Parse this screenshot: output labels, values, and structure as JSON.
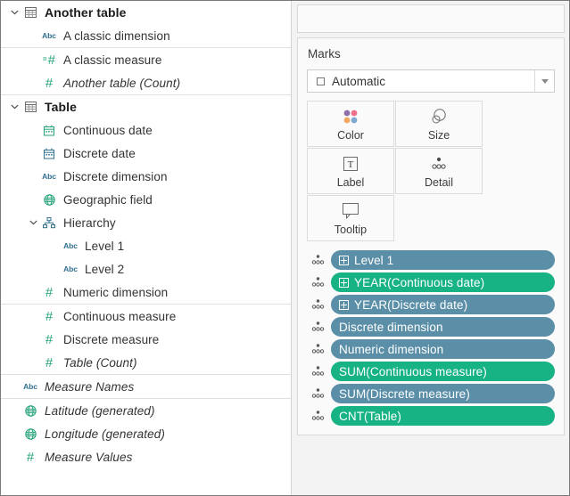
{
  "data_pane": {
    "groups": [
      {
        "name": "Another table",
        "icon": "table-icon",
        "expanded": true,
        "caret": "chevron-down-icon",
        "sections": [
          {
            "fields": [
              {
                "label": "A classic dimension",
                "icon": "abc-icon",
                "indent": 1,
                "italic": false
              }
            ]
          },
          {
            "fields": [
              {
                "label": "A classic measure",
                "icon": "calculated-measure-icon",
                "indent": 1,
                "italic": false
              },
              {
                "label": "Another table (Count)",
                "icon": "number-icon",
                "indent": 1,
                "italic": true
              }
            ]
          }
        ]
      },
      {
        "name": "Table",
        "icon": "table-icon",
        "expanded": true,
        "caret": "chevron-down-icon",
        "sections": [
          {
            "fields": [
              {
                "label": "Continuous date",
                "icon": "calendar-green-icon",
                "indent": 1,
                "italic": false
              },
              {
                "label": "Discrete date",
                "icon": "calendar-blue-icon",
                "indent": 1,
                "italic": false
              },
              {
                "label": "Discrete dimension",
                "icon": "abc-icon",
                "indent": 1,
                "italic": false
              },
              {
                "label": "Geographic field",
                "icon": "globe-icon",
                "indent": 1,
                "italic": false
              },
              {
                "label": "Hierarchy",
                "icon": "hierarchy-icon",
                "indent": 1,
                "italic": false,
                "caret": "chevron-down-icon"
              },
              {
                "label": "Level 1",
                "icon": "abc-icon",
                "indent": 2,
                "italic": false
              },
              {
                "label": "Level 2",
                "icon": "abc-icon",
                "indent": 2,
                "italic": false
              },
              {
                "label": "Numeric dimension",
                "icon": "number-icon",
                "indent": 1,
                "italic": false
              }
            ]
          },
          {
            "fields": [
              {
                "label": "Continuous measure",
                "icon": "number-icon",
                "indent": 1,
                "italic": false
              },
              {
                "label": "Discrete measure",
                "icon": "number-icon",
                "indent": 1,
                "italic": false
              },
              {
                "label": "Table (Count)",
                "icon": "number-icon",
                "indent": 1,
                "italic": true
              }
            ]
          }
        ]
      }
    ],
    "generated_sections": [
      {
        "fields": [
          {
            "label": "Measure Names",
            "icon": "abc-icon",
            "indent": 0,
            "italic": true
          }
        ]
      },
      {
        "fields": [
          {
            "label": "Latitude (generated)",
            "icon": "globe-icon",
            "indent": 0,
            "italic": true
          },
          {
            "label": "Longitude (generated)",
            "icon": "globe-icon",
            "indent": 0,
            "italic": true
          },
          {
            "label": "Measure Values",
            "icon": "number-icon",
            "indent": 0,
            "italic": true
          }
        ]
      }
    ]
  },
  "marks": {
    "title": "Marks",
    "mark_type": "Automatic",
    "mark_type_dropdown_icon": "chevron-down-icon",
    "buttons": [
      {
        "label": "Color",
        "icon": "color-dots-icon"
      },
      {
        "label": "Size",
        "icon": "size-shapes-icon"
      },
      {
        "label": "Label",
        "icon": "label-t-icon"
      },
      {
        "label": "Detail",
        "icon": "detail-dots-icon"
      },
      {
        "label": "Tooltip",
        "icon": "tooltip-bubble-icon"
      }
    ],
    "pills": [
      {
        "label": "Level 1",
        "color": "blue",
        "expandable": true
      },
      {
        "label": "YEAR(Continuous date)",
        "color": "green",
        "expandable": true
      },
      {
        "label": "YEAR(Discrete date)",
        "color": "blue",
        "expandable": true
      },
      {
        "label": "Discrete dimension",
        "color": "blue",
        "expandable": false
      },
      {
        "label": "Numeric dimension",
        "color": "blue",
        "expandable": false
      },
      {
        "label": "SUM(Continuous measure)",
        "color": "green",
        "expandable": false
      },
      {
        "label": "SUM(Discrete measure)",
        "color": "blue",
        "expandable": false
      },
      {
        "label": "CNT(Table)",
        "color": "green",
        "expandable": false
      }
    ]
  },
  "colors": {
    "pill_blue": "#5b8fa8",
    "pill_green": "#17b384",
    "dimension_blue": "#2f6f8f",
    "measure_green": "#23a37a",
    "panel_bg": "#f3f3f3",
    "card_bg": "#fafafa"
  }
}
